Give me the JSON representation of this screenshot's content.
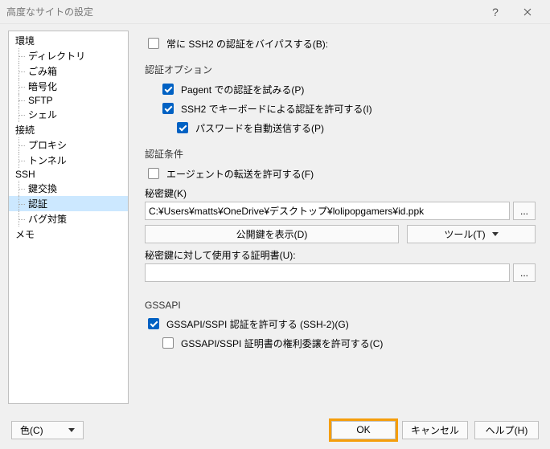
{
  "window": {
    "title": "高度なサイトの設定"
  },
  "tree": {
    "items": [
      {
        "label": "環境",
        "level": 0
      },
      {
        "label": "ディレクトリ",
        "level": 1
      },
      {
        "label": "ごみ箱",
        "level": 1
      },
      {
        "label": "暗号化",
        "level": 1
      },
      {
        "label": "SFTP",
        "level": 1
      },
      {
        "label": "シェル",
        "level": 1
      },
      {
        "label": "接続",
        "level": 0
      },
      {
        "label": "プロキシ",
        "level": 1
      },
      {
        "label": "トンネル",
        "level": 1
      },
      {
        "label": "SSH",
        "level": 0
      },
      {
        "label": "鍵交換",
        "level": 1
      },
      {
        "label": "認証",
        "level": 1,
        "selected": true
      },
      {
        "label": "バグ対策",
        "level": 1
      },
      {
        "label": "メモ",
        "level": 0
      }
    ]
  },
  "main": {
    "bypass_ssh2_auth": {
      "label": "常に SSH2 の認証をバイパスする(B):"
    },
    "auth_options_title": "認証オプション",
    "try_pagent": {
      "label": "Pagent での認証を試みる(P)"
    },
    "allow_keyboard": {
      "label": "SSH2 でキーボードによる認証を許可する(I)"
    },
    "auto_send_password": {
      "label": "パスワードを自動送信する(P)"
    },
    "auth_conditions_title": "認証条件",
    "allow_agent_forward": {
      "label": "エージェントの転送を許可する(F)"
    },
    "private_key_label": "秘密鍵(K)",
    "private_key_value": "C:¥Users¥matts¥OneDrive¥デスクトップ¥lolipopgamers¥id.ppk",
    "browse_label": "...",
    "show_pubkey": "公開鍵を表示(D)",
    "tools": "ツール(T)",
    "cert_label": "秘密鍵に対して使用する証明書(U):",
    "cert_value": "",
    "gssapi_title": "GSSAPI",
    "allow_gssapi": {
      "label": "GSSAPI/SSPI 認証を許可する (SSH-2)(G)"
    },
    "allow_gssapi_deleg": {
      "label": "GSSAPI/SSPI 証明書の権利委譲を許可する(C)"
    }
  },
  "footer": {
    "color": "色(C)",
    "ok": "OK",
    "cancel": "キャンセル",
    "help": "ヘルプ(H)"
  }
}
